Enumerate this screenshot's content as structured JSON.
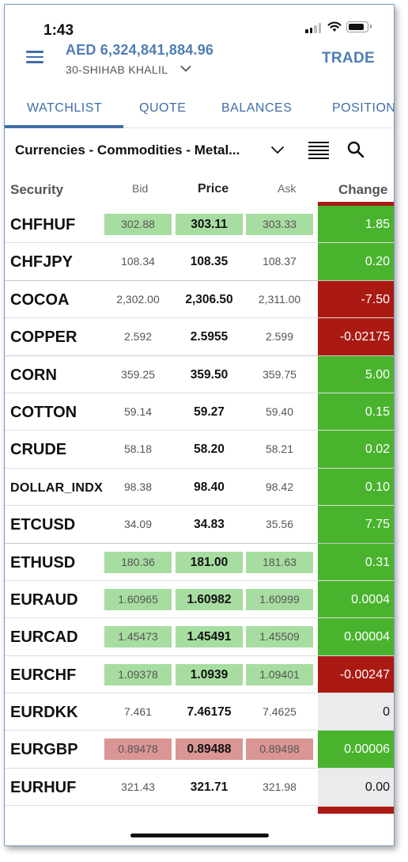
{
  "status": {
    "time": "1:43"
  },
  "header": {
    "balance": "AED 6,324,841,884.96",
    "account": "30-SHIHAB KHALIL",
    "trade_label": "TRADE"
  },
  "tabs": [
    {
      "label": "WATCHLIST",
      "active": true
    },
    {
      "label": "QUOTE"
    },
    {
      "label": "BALANCES"
    },
    {
      "label": "POSITION"
    }
  ],
  "watchlist": {
    "name": "Currencies - Commodities - Metal..."
  },
  "table": {
    "headers": {
      "security": "Security",
      "bid": "Bid",
      "price": "Price",
      "ask": "Ask",
      "change": "Change"
    },
    "rows": [
      {
        "security": "CHFHUF",
        "bid": "302.88",
        "price": "303.11",
        "ask": "303.33",
        "change": "1.85",
        "direction": "up",
        "highlight": "green"
      },
      {
        "security": "CHFJPY",
        "bid": "108.34",
        "price": "108.35",
        "ask": "108.37",
        "change": "0.20",
        "direction": "up",
        "highlight": "none"
      },
      {
        "security": "COCOA",
        "bid": "2,302.00",
        "price": "2,306.50",
        "ask": "2,311.00",
        "change": "-7.50",
        "direction": "down",
        "highlight": "none"
      },
      {
        "security": "COPPER",
        "bid": "2.592",
        "price": "2.5955",
        "ask": "2.599",
        "change": "-0.02175",
        "direction": "down",
        "highlight": "none"
      },
      {
        "security": "CORN",
        "bid": "359.25",
        "price": "359.50",
        "ask": "359.75",
        "change": "5.00",
        "direction": "up",
        "highlight": "none"
      },
      {
        "security": "COTTON",
        "bid": "59.14",
        "price": "59.27",
        "ask": "59.40",
        "change": "0.15",
        "direction": "up",
        "highlight": "none"
      },
      {
        "security": "CRUDE",
        "bid": "58.18",
        "price": "58.20",
        "ask": "58.21",
        "change": "0.02",
        "direction": "up",
        "highlight": "none"
      },
      {
        "security": "DOLLAR_INDX",
        "bid": "98.38",
        "price": "98.40",
        "ask": "98.42",
        "change": "0.10",
        "direction": "up",
        "highlight": "none"
      },
      {
        "security": "ETCUSD",
        "bid": "34.09",
        "price": "34.83",
        "ask": "35.56",
        "change": "7.75",
        "direction": "up",
        "highlight": "none"
      },
      {
        "security": "ETHUSD",
        "bid": "180.36",
        "price": "181.00",
        "ask": "181.63",
        "change": "0.31",
        "direction": "up",
        "highlight": "green"
      },
      {
        "security": "EURAUD",
        "bid": "1.60965",
        "price": "1.60982",
        "ask": "1.60999",
        "change": "0.0004",
        "direction": "up",
        "highlight": "green"
      },
      {
        "security": "EURCAD",
        "bid": "1.45473",
        "price": "1.45491",
        "ask": "1.45509",
        "change": "0.00004",
        "direction": "up",
        "highlight": "green"
      },
      {
        "security": "EURCHF",
        "bid": "1.09378",
        "price": "1.0939",
        "ask": "1.09401",
        "change": "-0.00247",
        "direction": "down",
        "highlight": "green"
      },
      {
        "security": "EURDKK",
        "bid": "7.461",
        "price": "7.46175",
        "ask": "7.4625",
        "change": "0",
        "direction": "flat",
        "highlight": "none"
      },
      {
        "security": "EURGBP",
        "bid": "0.89478",
        "price": "0.89488",
        "ask": "0.89498",
        "change": "0.00006",
        "direction": "up",
        "highlight": "red"
      },
      {
        "security": "EURHUF",
        "bid": "321.43",
        "price": "321.71",
        "ask": "321.98",
        "change": "0.00",
        "direction": "flat",
        "highlight": "none"
      }
    ]
  },
  "colors": {
    "accent": "#3f6ea8",
    "up": "#49b32e",
    "down": "#aa1a13",
    "flat": "#ebebeb",
    "highlight_green": "#a7dda0",
    "highlight_red": "#d99694"
  }
}
